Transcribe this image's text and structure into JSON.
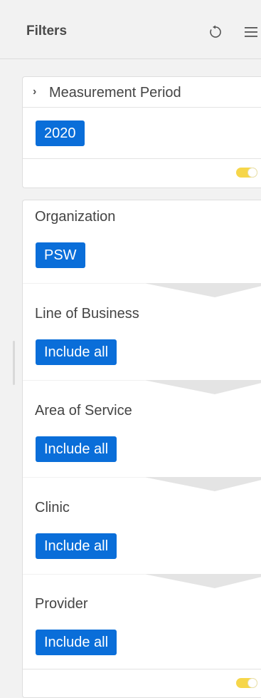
{
  "header": {
    "title": "Filters"
  },
  "icons": {
    "reset": "reset-icon",
    "menu": "hamburger-menu-icon",
    "expand": "chevron-right-icon"
  },
  "measurement_period": {
    "label": "Measurement Period",
    "value": "2020"
  },
  "filters": [
    {
      "label": "Organization",
      "value": "PSW"
    },
    {
      "label": "Line of Business",
      "value": "Include all"
    },
    {
      "label": "Area of Service",
      "value": "Include all"
    },
    {
      "label": "Clinic",
      "value": "Include all"
    },
    {
      "label": "Provider",
      "value": "Include all"
    }
  ],
  "colors": {
    "chip": "#0a6ed9",
    "toggle_on": "#f6d64a"
  }
}
